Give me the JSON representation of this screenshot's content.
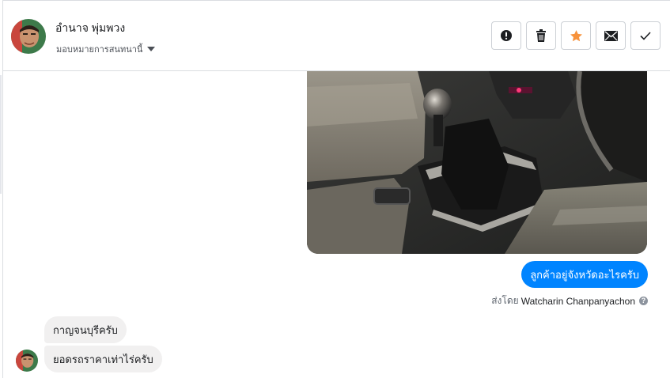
{
  "header": {
    "contact_name": "อำนาจ พุ่มพวง",
    "assign_label": "มอบหมายการสนทนานี้",
    "actions": [
      {
        "name": "report-spam-button",
        "icon": "exclamation-circle-icon"
      },
      {
        "name": "delete-button",
        "icon": "trash-icon"
      },
      {
        "name": "star-button",
        "icon": "star-icon",
        "color": "#f7923b"
      },
      {
        "name": "mark-unread-button",
        "icon": "envelope-icon"
      },
      {
        "name": "mark-done-button",
        "icon": "checkmark-icon"
      }
    ]
  },
  "conversation": {
    "outgoing_message": "ลูกค้าอยู่จังหวัดอะไรครับ",
    "sent_by_prefix": "ส่งโดย",
    "sent_by_name": "Watcharin Chanpanyachon",
    "incoming_messages": [
      "กาญจนบุรีครับ",
      "ยอดรถราคาเท่าไร่ครับ"
    ]
  },
  "colors": {
    "outgoing_bubble": "#0084ff",
    "incoming_bubble": "#f1f0f0",
    "star": "#f7923b"
  }
}
